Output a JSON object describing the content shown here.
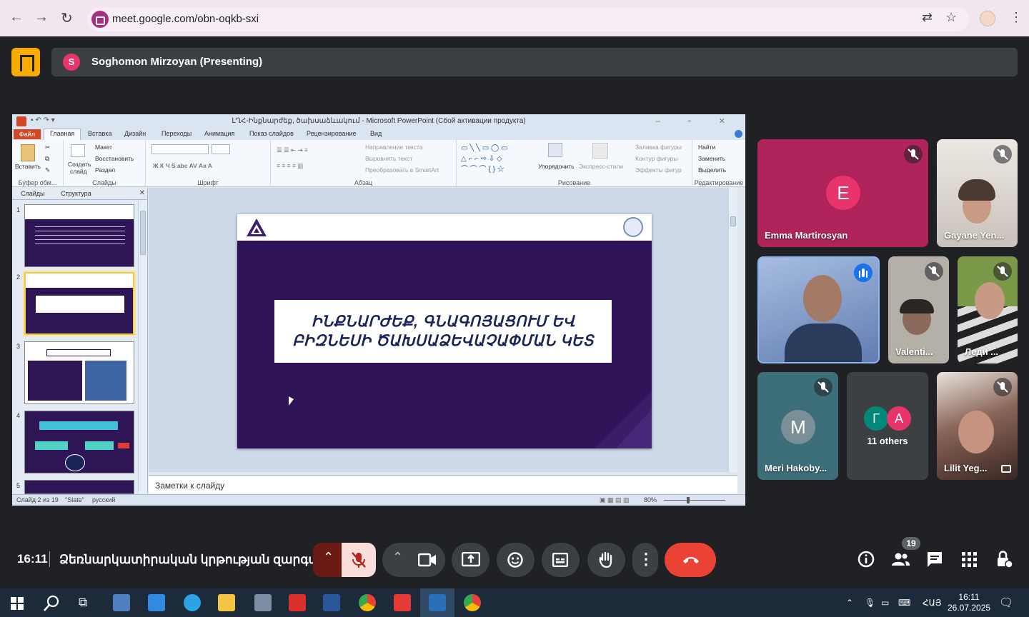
{
  "browser": {
    "url": "meet.google.com/obn-oqkb-sxi"
  },
  "meet": {
    "presenter_initial": "S",
    "presenter_label": "Soghomon Mirzoyan (Presenting)",
    "time": "16:11",
    "meeting_name": "Ձեռնարկատիրական կրթության զարգա...",
    "people_count": "19"
  },
  "ppt": {
    "title": "ԼՂՀ-Ինքնարժեք, ծախսաձևակում - Microsoft PowerPoint (Сбой активации продукта)",
    "tabs": [
      "Файл",
      "Главная",
      "Вставка",
      "Дизайн",
      "Переходы",
      "Анимация",
      "Показ слайдов",
      "Рецензирование",
      "Вид"
    ],
    "groups": {
      "clipboard": "Буфер обм...",
      "slides": "Слайды",
      "font": "Шрифт",
      "paragraph": "Абзац",
      "drawing": "Рисование",
      "editing": "Редактирование"
    },
    "buttons": {
      "paste": "Вставить",
      "create": "Создать",
      "slide": "слайд",
      "layout": "Макет",
      "reset": "Восстановить",
      "section": "Раздел",
      "text_dir": "Направление текста",
      "align_text": "Выровнять текст",
      "smartart": "Преобразовать в SmartArt",
      "arrange": "Упорядочить",
      "quick_styles": "Экспресс-стили",
      "fill": "Заливка фигуры",
      "outline": "Контур фигуры",
      "effects": "Эффекты фигур",
      "find": "Найти",
      "replace": "Заменить",
      "select": "Выделить"
    },
    "pane_tabs": [
      "Слайды",
      "Структура"
    ],
    "slide_nums": [
      "1",
      "2",
      "3",
      "4",
      "5"
    ],
    "slide_text_line1": "ԻՆՔՆԱՐԺԵՔ, ԳՆԱԳՈՅԱՑՈՒՄ ԵՎ",
    "slide_text_line2": "ԲԻԶՆԵՍԻ ԾԱԽՍԱՁԵՎԱՉԱՓՄԱՆ ԿԵՏ",
    "notes_placeholder": "Заметки к слайду",
    "status_slide": "Слайд 2 из 19",
    "status_theme": "\"Slate\"",
    "status_lang": "русский",
    "zoom": "80%"
  },
  "participants": [
    {
      "name": "Emma Martirosyan",
      "initial": "E",
      "color": "#e8336b"
    },
    {
      "name": "Gayane Yen..."
    },
    {
      "name": ""
    },
    {
      "name": "Valenti..."
    },
    {
      "name": "Леди ..."
    },
    {
      "name": "Meri Hakoby...",
      "initial": "M",
      "color": "#7b8f99"
    },
    {
      "name": "11 others",
      "initials": [
        "Г",
        "A"
      ],
      "colors": [
        "#00897b",
        "#e8336b"
      ]
    },
    {
      "name": "Lilit Yeg..."
    }
  ],
  "taskbar": {
    "lang": "ՀԱՅ",
    "time": "16:11",
    "date": "26.07.2025"
  },
  "icons": {
    "mic_off": "mic-off-icon",
    "camera": "camera-icon",
    "present": "present-icon",
    "emoji": "emoji-icon",
    "captions": "captions-icon",
    "hand": "raise-hand-icon",
    "more": "more-icon",
    "leave": "end-call-icon"
  }
}
